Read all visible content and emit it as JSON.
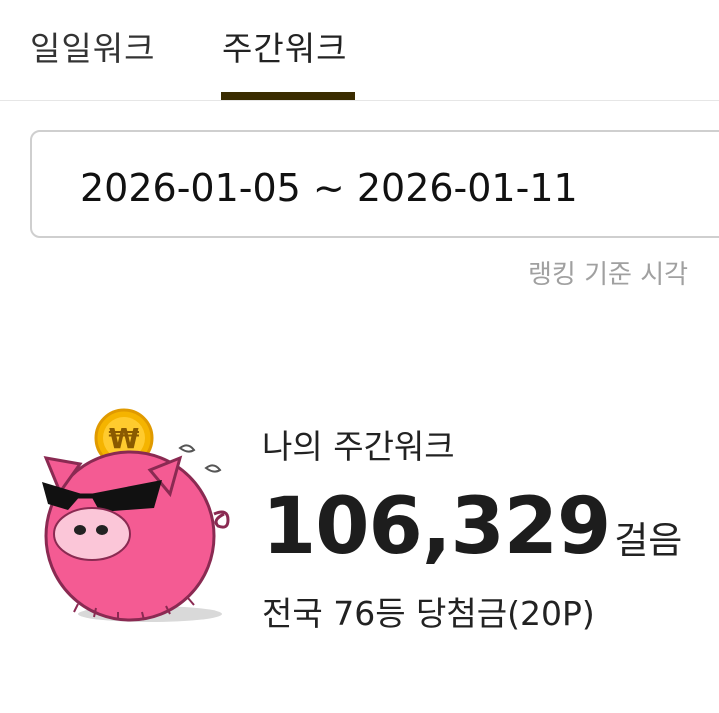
{
  "tabs": [
    {
      "label": "일일워크",
      "active": false
    },
    {
      "label": "주간워크",
      "active": true
    }
  ],
  "colors": {
    "active_tab_underline": "#3a2c00",
    "pig": "#f45b93",
    "coin": "#f5b400"
  },
  "date_range": "2026-01-05 ~ 2026-01-11",
  "ranking_basis_label": "랭킹 기준 시각",
  "summary": {
    "title": "나의 주간워크",
    "steps_value": "106,329",
    "steps_unit": "걸음",
    "rank_prize": "전국 76등 당첨금(20P)"
  },
  "icons": {
    "mascot": "pig-with-coin-icon",
    "coin_symbol": "₩"
  }
}
